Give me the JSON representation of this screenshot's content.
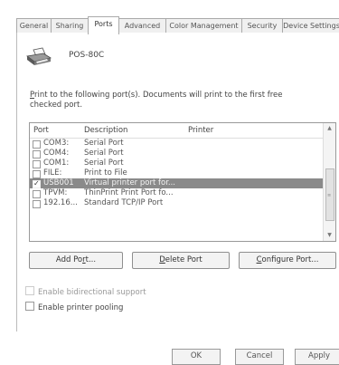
{
  "tabs": [
    {
      "label": "General",
      "active": false
    },
    {
      "label": "Sharing",
      "active": false
    },
    {
      "label": "Ports",
      "active": true
    },
    {
      "label": "Advanced",
      "active": false
    },
    {
      "label": "Color Management",
      "active": false
    },
    {
      "label": "Security",
      "active": false
    },
    {
      "label": "Device Settings",
      "active": false
    }
  ],
  "printer": {
    "name": "POS-80C",
    "icon": "printer-icon"
  },
  "instructions": {
    "first_letter": "P",
    "text": "rint to the following port(s). Documents will print to the first free checked port."
  },
  "port_list": {
    "columns": [
      "Port",
      "Description",
      "Printer"
    ],
    "rows": [
      {
        "port": "COM3:",
        "description": "Serial Port",
        "checked": false,
        "selected": false
      },
      {
        "port": "COM4:",
        "description": "Serial Port",
        "checked": false,
        "selected": false
      },
      {
        "port": "COM1:",
        "description": "Serial Port",
        "checked": false,
        "selected": false
      },
      {
        "port": "FILE:",
        "description": "Print to File",
        "checked": false,
        "selected": false
      },
      {
        "port": "USB001",
        "description": "Virtual printer port for...",
        "checked": true,
        "selected": true
      },
      {
        "port": "TPVM:",
        "description": "ThinPrint Print Port fo...",
        "checked": false,
        "selected": false
      },
      {
        "port": "192.16...",
        "description": "Standard TCP/IP Port",
        "checked": false,
        "selected": false
      }
    ]
  },
  "buttons": {
    "add_port": {
      "pre": "Add Po",
      "u": "r",
      "post": "t..."
    },
    "delete_port": {
      "pre": "",
      "u": "D",
      "post": "elete Port"
    },
    "configure_port": {
      "pre": "",
      "u": "C",
      "post": "onfigure Port..."
    }
  },
  "options": {
    "bidirectional": {
      "label": "Enable bidirectional support",
      "checked": false,
      "enabled": false
    },
    "pooling": {
      "label": "Enable printer pooling",
      "checked": false,
      "enabled": true
    }
  },
  "dialog_buttons": {
    "ok": "OK",
    "cancel": "Cancel",
    "apply": "Apply"
  }
}
